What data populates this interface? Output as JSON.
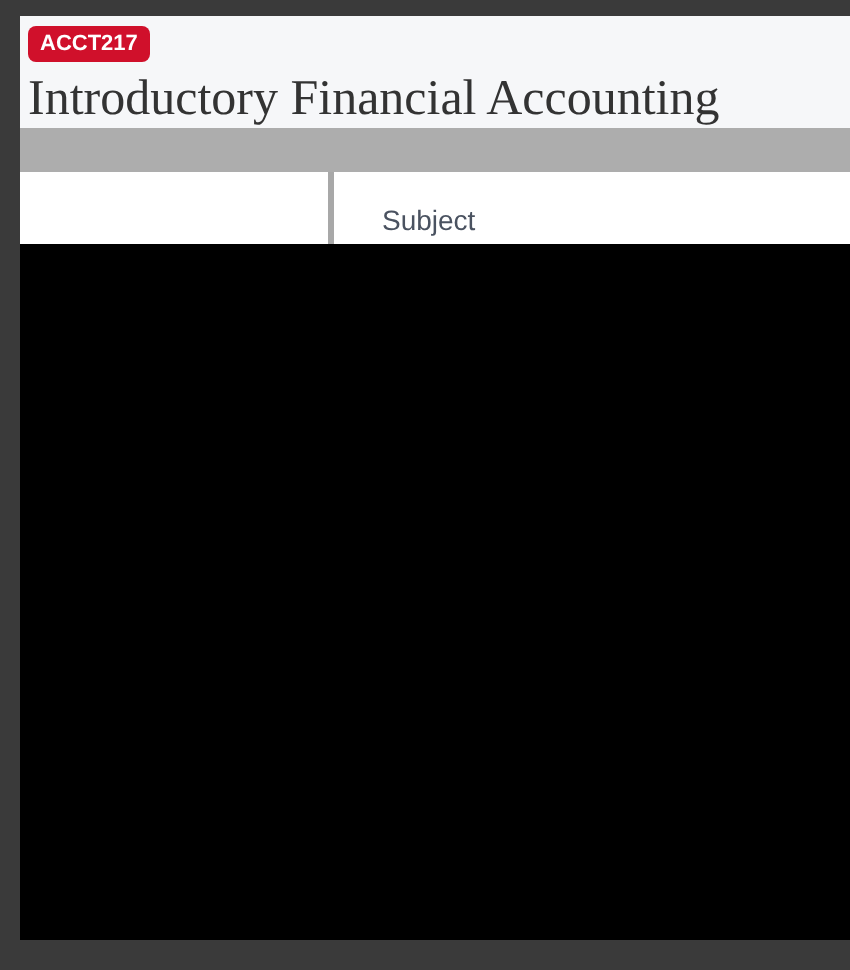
{
  "course_badge": "ACCT217",
  "title": "Introductory Financial Accounting",
  "detail_panel": {
    "label": "Subject"
  }
}
